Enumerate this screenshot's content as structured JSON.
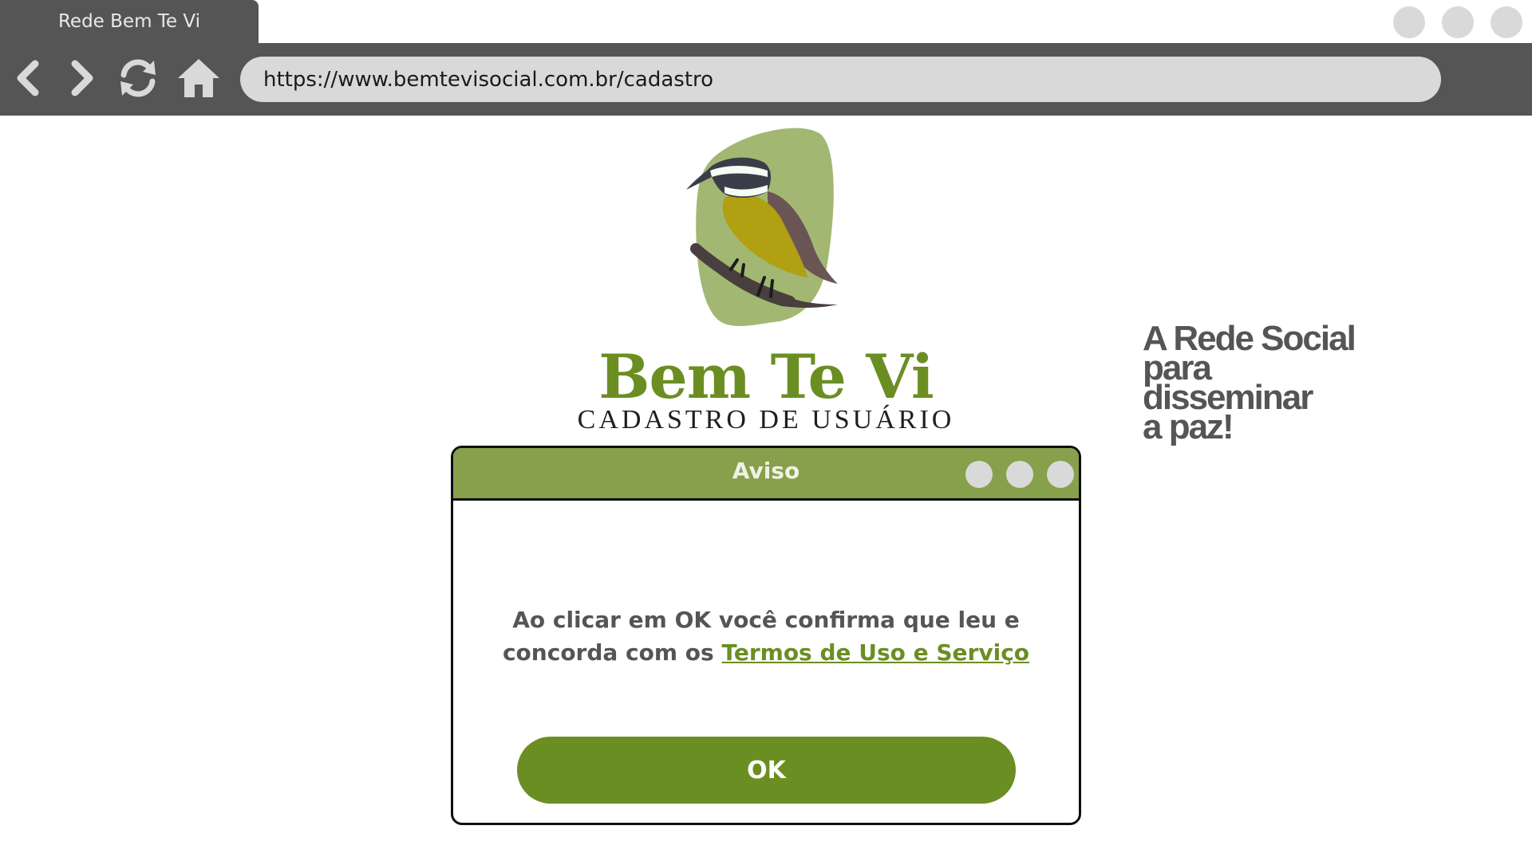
{
  "browser": {
    "tab_title": "Rede Bem Te Vi",
    "url": "https://www.bemtevisocial.com.br/cadastro",
    "nav_icons": [
      "back-icon",
      "forward-icon",
      "refresh-icon",
      "home-icon"
    ],
    "window_controls": 3
  },
  "brand": {
    "name": "Bem Te Vi",
    "subtitle": "CADASTRO DE USUÁRIO"
  },
  "tagline": "A Rede Social\npara\ndisseminar\na paz!",
  "dialog": {
    "title": "Aviso",
    "message_prefix": "Ao clicar em OK você confirma que leu e concorda com os ",
    "terms_link": "Termos de Uso e Serviço",
    "ok_label": "OK"
  },
  "colors": {
    "chrome": "#555555",
    "brand_green": "#6b8e23",
    "dialog_header": "#86a04c",
    "control_gray": "#d9d9d9"
  }
}
